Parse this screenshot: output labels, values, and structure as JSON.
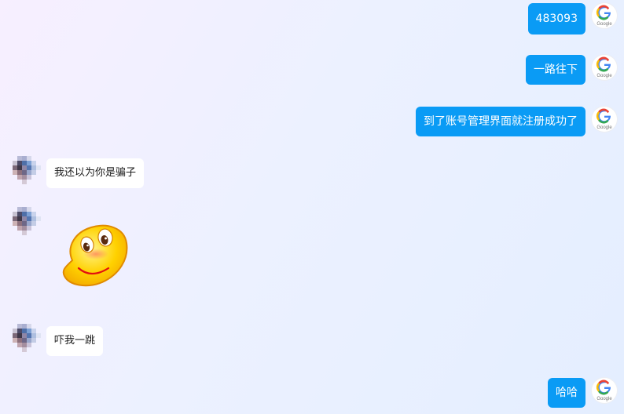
{
  "messages": [
    {
      "from": "me",
      "text": "483093",
      "avatar_icon": "google-logo-icon"
    },
    {
      "from": "me",
      "text": "一路往下",
      "avatar_icon": "google-logo-icon"
    },
    {
      "from": "me",
      "text": "到了账号管理界面就注册成功了",
      "avatar_icon": "google-logo-icon"
    },
    {
      "from": "other",
      "text": "我还以为你是骗子",
      "avatar_icon": "pixelated-avatar-icon"
    },
    {
      "from": "other",
      "sticker": "smiley-emoji-sticker",
      "avatar_icon": "pixelated-avatar-icon"
    },
    {
      "from": "other",
      "text": "吓我一跳",
      "avatar_icon": "pixelated-avatar-icon"
    },
    {
      "from": "me",
      "text": "哈哈",
      "avatar_icon": "google-logo-icon"
    }
  ],
  "colors": {
    "outgoing_bubble": "#0a9bf5",
    "incoming_bubble": "#ffffff"
  }
}
